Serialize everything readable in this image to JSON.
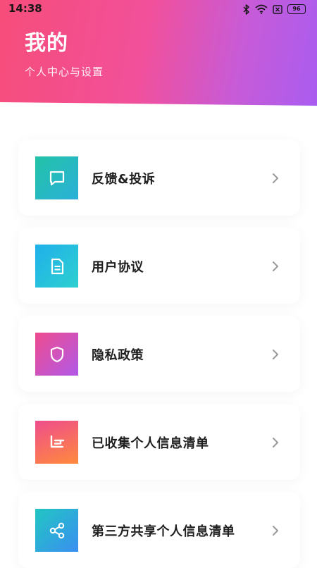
{
  "status_bar": {
    "time": "14:38",
    "battery": "96"
  },
  "header": {
    "title": "我的",
    "subtitle": "个人中心与设置"
  },
  "menu": {
    "items": [
      {
        "label": "反馈&投诉",
        "icon": "chat-bubble-icon",
        "gradient": [
          "#22c3a6",
          "#2bb0d9"
        ]
      },
      {
        "label": "用户协议",
        "icon": "document-icon",
        "gradient": [
          "#1fb0ea",
          "#2dd0d0"
        ]
      },
      {
        "label": "隐私政策",
        "icon": "shield-icon",
        "gradient": [
          "#ee4b8e",
          "#b15ae8"
        ]
      },
      {
        "label": "已收集个人信息清单",
        "icon": "collection-icon",
        "gradient": [
          "#ef4d8c",
          "#ff8a3d"
        ]
      },
      {
        "label": "第三方共享个人信息清单",
        "icon": "share-icon",
        "gradient": [
          "#21c6c3",
          "#3a8ff0"
        ]
      }
    ]
  },
  "colors": {
    "header_start": "#f64d7a",
    "header_end": "#a95cf0",
    "label_text": "#1f1f1f",
    "chevron": "#9a9a9a"
  }
}
